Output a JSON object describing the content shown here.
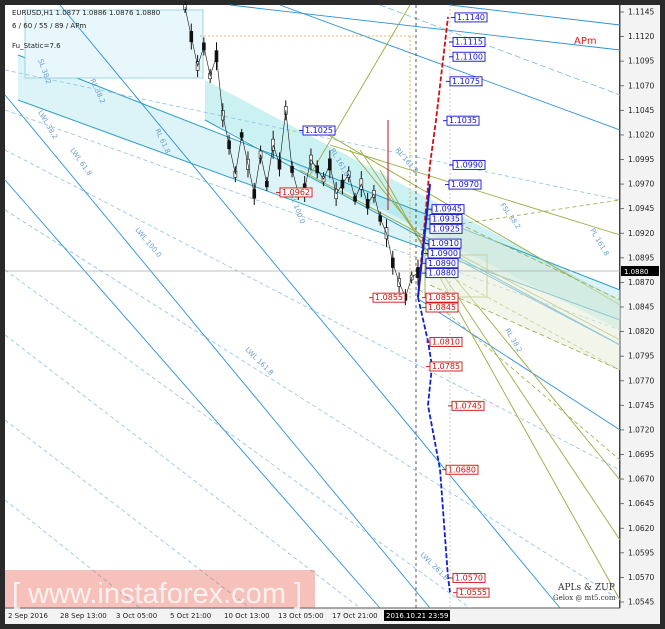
{
  "header": {
    "symbol_line": "EURUSD,H1  1.0877 1.0886 1.0876 1.0880",
    "params_line": "6 / 60 / 55 / 89 / APm",
    "static_line": "Fu_Static=7.6",
    "apm_label": "APm"
  },
  "chart_data": {
    "type": "line",
    "ylim": [
      1.0545,
      1.1145
    ],
    "price_axis_labels": [
      "1.1145",
      "1.1120",
      "1.1095",
      "1.1070",
      "1.1045",
      "1.1020",
      "1.0995",
      "1.0970",
      "1.0945",
      "1.0920",
      "1.0895",
      "1.0870",
      "1.0845",
      "1.0820",
      "1.0795",
      "1.0770",
      "1.0745",
      "1.0720",
      "1.0695",
      "1.0670",
      "1.0645",
      "1.0620",
      "1.0595",
      "1.0570",
      "1.0545"
    ],
    "current_price": "1.0880",
    "time_labels": [
      "2 Sep 2016",
      "28 Sep 13:00",
      "3 Oct 05:00",
      "5 Oct 21:00",
      "10 Oct 13:00",
      "13 Oct 05:00",
      "17 Oct 21:00"
    ],
    "cursor_time": "2016.10.21 23:59",
    "price_series": [
      1.115,
      1.112,
      1.109,
      1.111,
      1.108,
      1.11,
      1.104,
      1.101,
      1.098,
      1.102,
      1.099,
      1.096,
      1.1,
      1.097,
      1.101,
      1.099,
      1.1045,
      1.0985,
      1.096,
      1.0965,
      1.0995,
      1.0985,
      1.0975,
      1.099,
      1.096,
      1.097,
      1.098,
      1.0955,
      1.097,
      1.095,
      1.096,
      1.0935,
      1.092,
      1.089,
      1.087,
      1.0855,
      1.0875,
      1.088
    ],
    "blue_projection": [
      {
        "label": "1.0855",
        "price": 1.0855
      },
      {
        "label": "1.0810",
        "price": 1.081
      },
      {
        "label": "1.0785",
        "price": 1.0785
      },
      {
        "label": "1.0745",
        "price": 1.0745
      },
      {
        "label": "1.0680",
        "price": 1.068
      },
      {
        "label": "1.0570",
        "price": 1.057
      },
      {
        "label": "1.0555",
        "price": 1.0555
      }
    ],
    "red_projection": [
      {
        "label": "1.0855",
        "price": 1.0855
      },
      {
        "label": "1.0990",
        "price": 1.099
      },
      {
        "label": "1.1035",
        "price": 1.1035
      },
      {
        "label": "1.1140",
        "price": 1.114
      }
    ],
    "upper_targets": [
      {
        "label": "1.1140",
        "price": 1.114
      },
      {
        "label": "1.1115",
        "price": 1.1115
      },
      {
        "label": "1.1100",
        "price": 1.11
      },
      {
        "label": "1.1075",
        "price": 1.1075
      },
      {
        "label": "1.1035",
        "price": 1.1035
      },
      {
        "label": "1.0990",
        "price": 1.099
      },
      {
        "label": "1.0970",
        "price": 1.097
      },
      {
        "label": "1.0945",
        "price": 1.0945
      },
      {
        "label": "1.0935",
        "price": 1.0935
      },
      {
        "label": "1.0925",
        "price": 1.0925
      },
      {
        "label": "1.0910",
        "price": 1.091
      },
      {
        "label": "1.0900",
        "price": 1.09
      },
      {
        "label": "1.0890",
        "price": 1.089
      },
      {
        "label": "1.0880",
        "price": 1.088
      }
    ],
    "lower_targets": [
      {
        "label": "1.0855",
        "price": 1.0855
      },
      {
        "label": "1.0845",
        "price": 1.0845
      },
      {
        "label": "1.0810",
        "price": 1.081
      },
      {
        "label": "1.0785",
        "price": 1.0785
      },
      {
        "label": "1.0745",
        "price": 1.0745
      },
      {
        "label": "1.0680",
        "price": 1.068
      },
      {
        "label": "1.0570",
        "price": 1.057
      },
      {
        "label": "1.0555",
        "price": 1.0555
      }
    ],
    "pivot_labels": [
      {
        "label": "1.1025",
        "price": 1.1025,
        "color": "blue"
      },
      {
        "label": "1.0962",
        "price": 1.0962,
        "color": "red"
      },
      {
        "label": "1.0855",
        "price": 1.0855,
        "color": "red"
      }
    ],
    "level_labels": [
      "LWL 38.2",
      "LWL 61.8",
      "LWL 100.0",
      "LWL 161.8",
      "LWL 261.8",
      "RL 38.2",
      "RL 61.8",
      "RL 100.0",
      "RL 161.8",
      "SL 38.2",
      "FSL 38.2",
      "RL 161.8",
      "PL 161.8",
      "RL 38.2"
    ]
  },
  "watermark": {
    "text": "[ www.instaforex.com ]"
  },
  "signature": {
    "line1": "APLs & ZUP",
    "line2": "Gelox @ mt5.com"
  }
}
